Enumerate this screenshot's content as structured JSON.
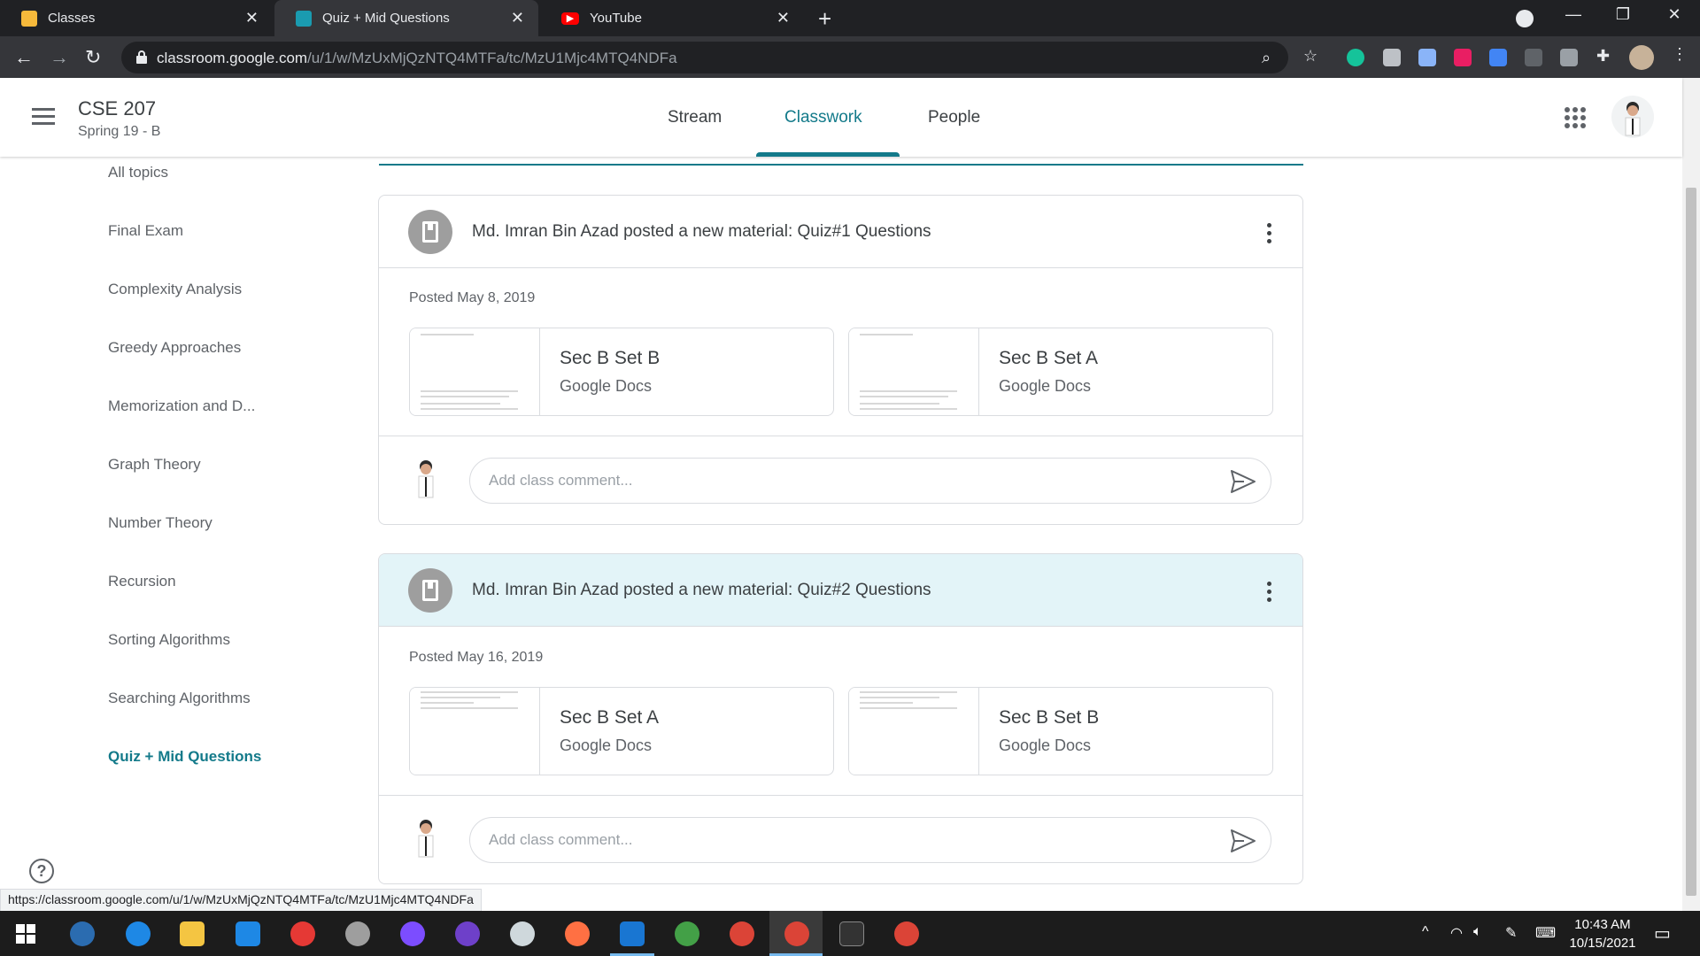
{
  "browser": {
    "tabs": [
      {
        "title": "Classes",
        "favicon_color": "#f6b93b",
        "active": false
      },
      {
        "title": "Quiz + Mid Questions",
        "favicon_color": "#1a9bb0",
        "active": true
      },
      {
        "title": "YouTube",
        "favicon_color": "#ff0000",
        "active": false
      }
    ],
    "url_host": "classroom.google.com",
    "url_path": "/u/1/w/MzUxMjQzNTQ4MTFa/tc/MzU1Mjc4MTQ4NDFa",
    "status_url": "https://classroom.google.com/u/1/w/MzUxMjQzNTQ4MTFa/tc/MzU1Mjc4MTQ4NDFa"
  },
  "header": {
    "class_name": "CSE 207",
    "section": "Spring 19 - B",
    "tabs": [
      "Stream",
      "Classwork",
      "People"
    ],
    "active_tab": "Classwork",
    "accent": "#137a8a"
  },
  "sidebar": {
    "topics": [
      "All topics",
      "Final Exam",
      "Complexity Analysis",
      "Greedy Approaches",
      "Memorization and D...",
      "Graph Theory",
      "Number Theory",
      "Recursion",
      "Sorting Algorithms",
      "Searching Algorithms",
      "Quiz + Mid Questions"
    ],
    "active": "Quiz + Mid Questions"
  },
  "posts": [
    {
      "title": "Md. Imran Bin Azad posted a new material: Quiz#1 Questions",
      "posted": "Posted May 8, 2019",
      "attachments": [
        {
          "title": "Sec B Set B",
          "type": "Google Docs"
        },
        {
          "title": "Sec B Set A",
          "type": "Google Docs"
        }
      ],
      "comment_placeholder": "Add class comment..."
    },
    {
      "title": "Md. Imran Bin Azad posted a new material: Quiz#2 Questions",
      "posted": "Posted May 16, 2019",
      "attachments": [
        {
          "title": "Sec B Set A",
          "type": "Google Docs"
        },
        {
          "title": "Sec B Set B",
          "type": "Google Docs"
        }
      ],
      "comment_placeholder": "Add class comment..."
    }
  ],
  "taskbar": {
    "time": "10:43 AM",
    "date": "10/15/2021"
  }
}
